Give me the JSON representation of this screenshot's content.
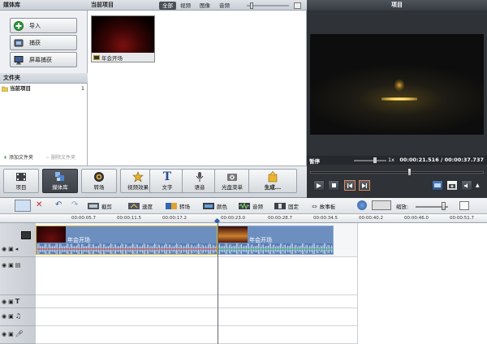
{
  "media_library": {
    "title": "媒体库",
    "buttons": [
      {
        "label": "导入",
        "icon": "plus-icon"
      },
      {
        "label": "捕获",
        "icon": "capture-icon"
      },
      {
        "label": "屏幕捕获",
        "icon": "monitor-icon"
      }
    ]
  },
  "folders": {
    "title": "文件夹",
    "items": [
      {
        "label": "当前项目",
        "count": "1"
      }
    ],
    "add_label": "添加文件夹",
    "delete_label": "删除文件夹"
  },
  "current_project": {
    "title": "当前项目",
    "tabs": [
      "全部",
      "视频",
      "图像",
      "音频"
    ],
    "active_tab": "全部",
    "clips": [
      {
        "label": "年会开场"
      }
    ]
  },
  "preview": {
    "title": "项目",
    "status": "暂停",
    "speed": "1x",
    "time": "00:00:21.516 / 00:00:37.737"
  },
  "toolbar": {
    "buttons": [
      "项目",
      "媒体库",
      "转场",
      "视频效果",
      "文字",
      "语音",
      "光盘菜单",
      "生成..."
    ],
    "active": "媒体库"
  },
  "edit_toolbar": {
    "items": [
      "截剪",
      "速度",
      "转场",
      "颜色",
      "音频",
      "固定"
    ],
    "storyboard_label": "故事板",
    "zoom_label": "缩放:"
  },
  "timeline": {
    "ruler": [
      "00:00:05.7",
      "00:00:11.5",
      "00:00:17.2",
      "00:00:23.0",
      "00:00:28.7",
      "00:00:34.5",
      "00:00:40.2",
      "00:00:46.0",
      "00:00:51.7"
    ],
    "clips": [
      {
        "label": "年会开场",
        "start": 0,
        "end": 23.0
      },
      {
        "label": "年会开场",
        "start": 23.0,
        "end": 37.7
      }
    ],
    "playhead": 21.5
  },
  "colors": {
    "accent": "#4a7fc4",
    "clip": "#6d8fc0",
    "toolbar_dark": "#3c4148"
  }
}
